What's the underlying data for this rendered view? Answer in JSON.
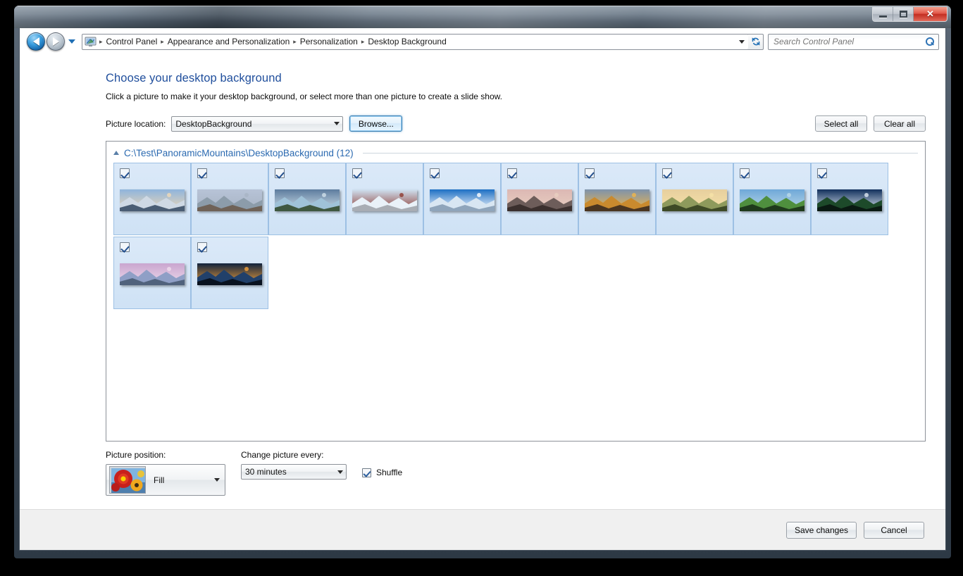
{
  "window": {
    "controls": {
      "minimize": "Minimize",
      "maximize": "Maximize",
      "close": "✕"
    }
  },
  "navbar": {
    "back_tooltip": "Back",
    "forward_tooltip": "Forward",
    "recent_tooltip": "Recent pages",
    "refresh_tooltip": "Refresh",
    "breadcrumbs": [
      "Control Panel",
      "Appearance and Personalization",
      "Personalization",
      "Desktop Background"
    ],
    "separator": "▸",
    "search": {
      "placeholder": "Search Control Panel",
      "value": ""
    }
  },
  "main": {
    "title": "Choose your desktop background",
    "subtitle": "Click a picture to make it your desktop background, or select more than one picture to create a slide show.",
    "picture_location_label": "Picture location:",
    "picture_location_value": "DesktopBackground",
    "browse_label": "Browse...",
    "select_all_label": "Select all",
    "clear_all_label": "Clear all"
  },
  "gallery": {
    "group_title": "C:\\Test\\PanoramicMountains\\DesktopBackground (12)",
    "item_count": 12,
    "all_selected": true,
    "items": [
      {
        "name": "snowy-peak-sunrise",
        "selected": true,
        "sky": "#8fb4dc",
        "mid": "#cfd9e4",
        "land": "#4a5d74",
        "accent": "#f0d9b6"
      },
      {
        "name": "alpine-lake-mountains",
        "selected": true,
        "sky": "#b7c3d7",
        "mid": "#8c9caa",
        "land": "#6f6257",
        "accent": "#a8b4c4"
      },
      {
        "name": "rocky-shore-clouds",
        "selected": true,
        "sky": "#5d7c9e",
        "mid": "#9fc2d8",
        "land": "#3f5840",
        "accent": "#cfe0ea"
      },
      {
        "name": "snow-village-valley",
        "selected": true,
        "sky": "#cfe2f2",
        "mid": "#e9f1f8",
        "land": "#a8adb4",
        "accent": "#8e3a30"
      },
      {
        "name": "peak-above-clouds",
        "selected": true,
        "sky": "#1d6fc4",
        "mid": "#d8e6f2",
        "land": "#8fa5bb",
        "accent": "#ffffff"
      },
      {
        "name": "three-peaks-dusk",
        "selected": true,
        "sky": "#dcb8b4",
        "mid": "#6d5d5a",
        "land": "#3b302e",
        "accent": "#e8cfc0"
      },
      {
        "name": "golden-cliffs-sunset",
        "selected": true,
        "sky": "#7e93ab",
        "mid": "#c98a2e",
        "land": "#4a3520",
        "accent": "#f0b64a"
      },
      {
        "name": "highland-sunrise-road",
        "selected": true,
        "sky": "#e7cf9e",
        "mid": "#8e9a5c",
        "land": "#3e4a26",
        "accent": "#f6e2a8"
      },
      {
        "name": "green-valley-stream",
        "selected": true,
        "sky": "#6fa8d8",
        "mid": "#4f8f3e",
        "land": "#1f3a1c",
        "accent": "#bcd9e8"
      },
      {
        "name": "mountain-lake-reflection",
        "selected": true,
        "sky": "#12305c",
        "mid": "#1d4a2a",
        "land": "#0a1a12",
        "accent": "#dfe9f2"
      },
      {
        "name": "crater-lake-twilight",
        "selected": true,
        "sky": "#c9a5cf",
        "mid": "#8f9fc6",
        "land": "#50627c",
        "accent": "#efdcec"
      },
      {
        "name": "sunset-peak-mirror-lake",
        "selected": true,
        "sky": "#12233d",
        "mid": "#21406a",
        "land": "#09121f",
        "accent": "#f3a23c"
      }
    ]
  },
  "options": {
    "picture_position_label": "Picture position:",
    "picture_position_value": "Fill",
    "change_picture_label": "Change picture every:",
    "change_picture_value": "30 minutes",
    "shuffle_label": "Shuffle",
    "shuffle_checked": true
  },
  "commandbar": {
    "save_label": "Save changes",
    "cancel_label": "Cancel"
  },
  "colors": {
    "link_blue": "#1f4e9c",
    "group_blue": "#2a69b0",
    "selection_blue": "#cfe2f5",
    "close_red": "#c22e21"
  }
}
